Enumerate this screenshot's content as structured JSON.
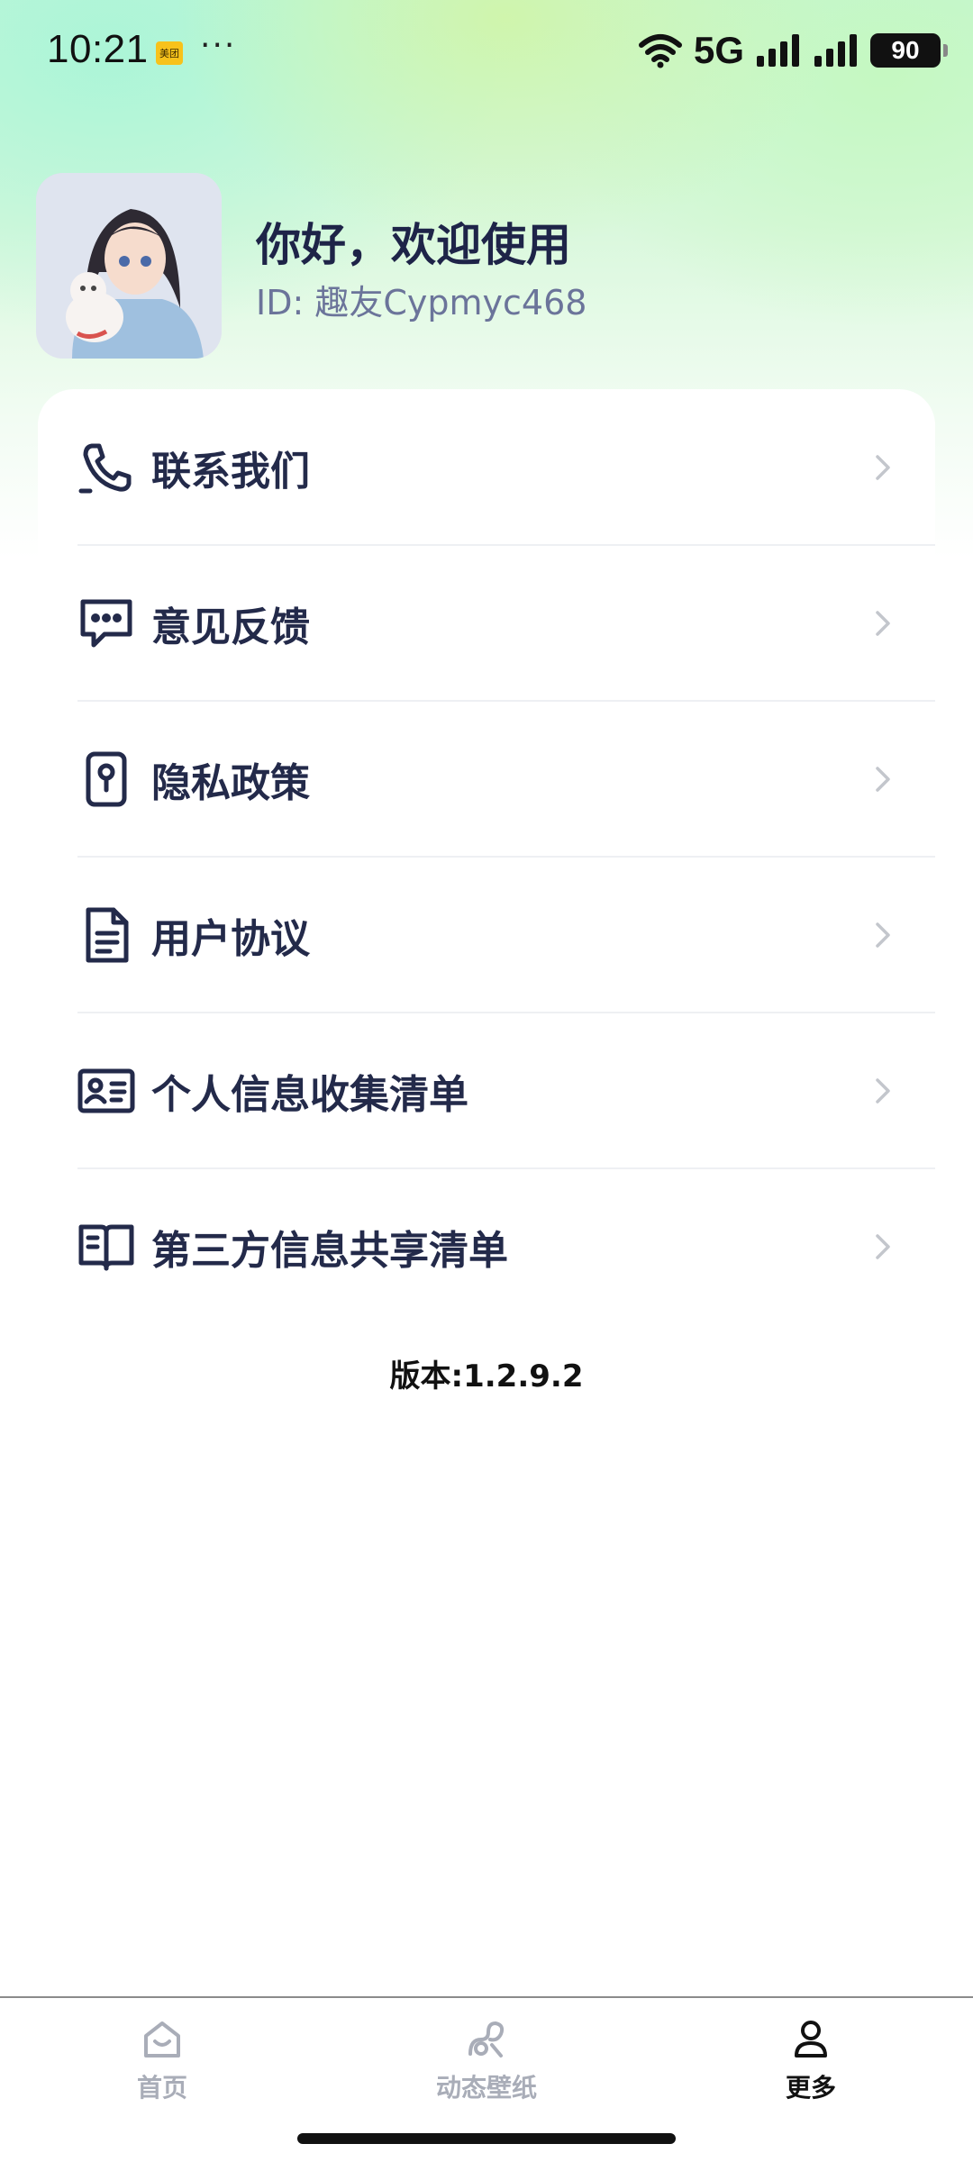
{
  "status_bar": {
    "time": "10:21",
    "app_badge": "美团",
    "dots": "···",
    "network": "5G",
    "battery": "90"
  },
  "profile": {
    "greeting": "你好，欢迎使用",
    "user_id": "ID: 趣友Cypmyc468"
  },
  "menu": {
    "items": [
      {
        "label": "联系我们",
        "icon": "phone-icon"
      },
      {
        "label": "意见反馈",
        "icon": "chat-bubble-icon"
      },
      {
        "label": "隐私政策",
        "icon": "privacy-keyhole-icon"
      },
      {
        "label": "用户协议",
        "icon": "document-icon"
      },
      {
        "label": "个人信息收集清单",
        "icon": "id-card-icon"
      },
      {
        "label": "第三方信息共享清单",
        "icon": "open-book-icon"
      }
    ]
  },
  "version": "版本:1.2.9.2",
  "tabbar": {
    "tabs": [
      {
        "label": "首页",
        "icon": "home-icon",
        "active": false
      },
      {
        "label": "动态壁纸",
        "icon": "wallpaper-icon",
        "active": false
      },
      {
        "label": "更多",
        "icon": "person-icon",
        "active": true
      }
    ]
  },
  "colors": {
    "text_primary": "#232a4a",
    "text_id": "#6b749a",
    "chevron": "#c3c6cc",
    "tab_inactive": "#a9adb8",
    "tab_active": "#111111"
  }
}
